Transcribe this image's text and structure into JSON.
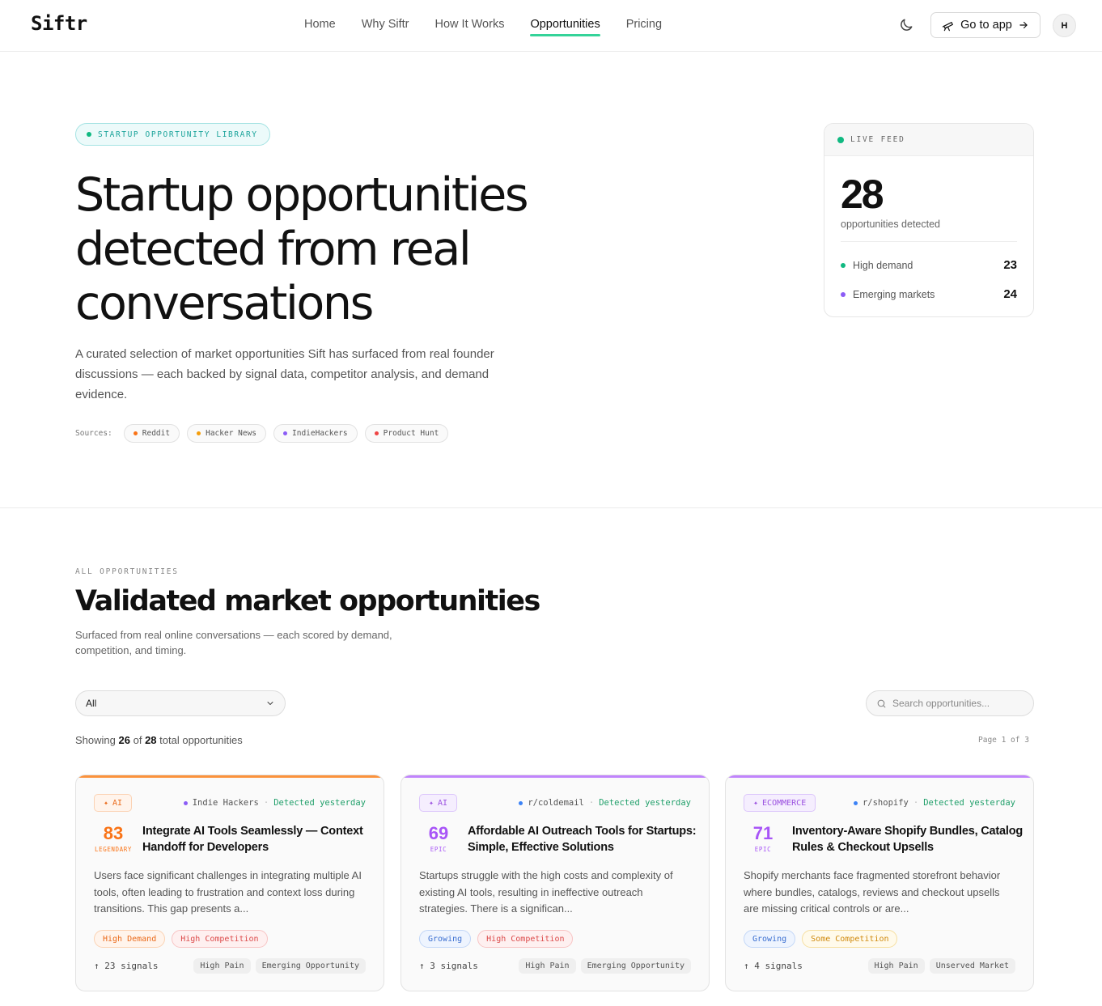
{
  "brand": {
    "logo": "Siftr"
  },
  "nav": {
    "links": [
      "Home",
      "Why Siftr",
      "How It Works",
      "Opportunities",
      "Pricing"
    ],
    "active": "Opportunities",
    "go_to_app": "Go to app",
    "avatar_initial": "H"
  },
  "hero": {
    "pill": "STARTUP OPPORTUNITY LIBRARY",
    "title": "Startup opportunities detected from real conversations",
    "description": "A curated selection of market opportunities Sift has surfaced from real founder discussions — each backed by signal data, competitor analysis, and demand evidence.",
    "sources_label": "Sources:",
    "sources": [
      {
        "name": "Reddit",
        "color": "#f97316"
      },
      {
        "name": "Hacker News",
        "color": "#f59e0b"
      },
      {
        "name": "IndieHackers",
        "color": "#8b5cf6"
      },
      {
        "name": "Product Hunt",
        "color": "#ef4444"
      }
    ]
  },
  "live_feed": {
    "label": "LIVE FEED",
    "count": "28",
    "count_label": "opportunities detected",
    "rows": [
      {
        "label": "High demand",
        "value": "23",
        "color": "#10b981"
      },
      {
        "label": "Emerging markets",
        "value": "24",
        "color": "#8b5cf6"
      }
    ]
  },
  "opportunities": {
    "eyebrow": "ALL OPPORTUNITIES",
    "title": "Validated market opportunities",
    "description": "Surfaced from real online conversations — each scored by demand, competition, and timing.",
    "filter_value": "All",
    "search_placeholder": "Search opportunities...",
    "showing_prefix": "Showing",
    "showing_count": "26",
    "showing_of": "of",
    "showing_total": "28",
    "showing_suffix": "total opportunities",
    "page_info": "Page 1 of 3"
  },
  "cards": [
    {
      "accent": "#fb923c",
      "category": "AI",
      "source": "Indie Hackers",
      "source_color": "#8b5cf6",
      "detected": "Detected yesterday",
      "score": "83",
      "tier": "LEGENDARY",
      "score_color": "#f97316",
      "title": "Integrate AI Tools Seamlessly — Context Handoff for Developers",
      "description": "Users face significant challenges in integrating multiple AI tools, often leading to frustration and context loss during transitions. This gap presents a...",
      "tags": [
        {
          "label": "High Demand",
          "kind": "orange"
        },
        {
          "label": "High Competition",
          "kind": "red"
        }
      ],
      "signals": "↑ 23 signals",
      "footer_tags": [
        "High Pain",
        "Emerging Opportunity"
      ]
    },
    {
      "accent": "#c084fc",
      "category": "AI",
      "source": "r/coldemail",
      "source_color": "#3b82f6",
      "detected": "Detected yesterday",
      "score": "69",
      "tier": "EPIC",
      "score_color": "#a855f7",
      "title": "Affordable AI Outreach Tools for Startups: Simple, Effective Solutions",
      "description": "Startups struggle with the high costs and complexity of existing AI tools, resulting in ineffective outreach strategies. There is a significan...",
      "tags": [
        {
          "label": "Growing",
          "kind": "blue"
        },
        {
          "label": "High Competition",
          "kind": "red"
        }
      ],
      "signals": "↑ 3 signals",
      "footer_tags": [
        "High Pain",
        "Emerging Opportunity"
      ]
    },
    {
      "accent": "#c084fc",
      "category": "ECOMMERCE",
      "source": "r/shopify",
      "source_color": "#3b82f6",
      "detected": "Detected yesterday",
      "score": "71",
      "tier": "EPIC",
      "score_color": "#a855f7",
      "title": "Inventory-Aware Shopify Bundles, Catalog Rules & Checkout Upsells",
      "description": "Shopify merchants face fragmented storefront behavior where bundles, catalogs, reviews and checkout upsells are missing critical controls or are...",
      "tags": [
        {
          "label": "Growing",
          "kind": "blue"
        },
        {
          "label": "Some Competition",
          "kind": "amber"
        }
      ],
      "signals": "↑ 4 signals",
      "footer_tags": [
        "High Pain",
        "Unserved Market"
      ]
    }
  ]
}
